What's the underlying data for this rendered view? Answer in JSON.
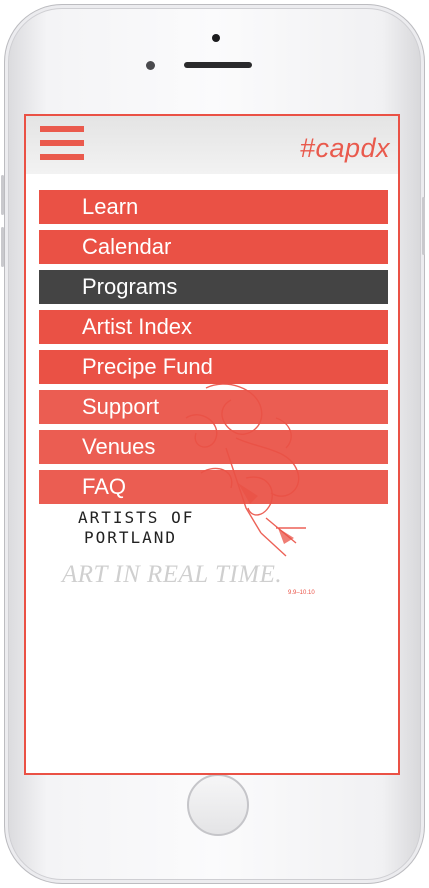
{
  "app": {
    "hashtag": "#capdx",
    "accent_color": "#ea5145",
    "active_color": "#444444"
  },
  "header": {
    "menu_icon": "hamburger-icon"
  },
  "menu": {
    "items": [
      {
        "label": "Learn"
      },
      {
        "label": "Calendar"
      },
      {
        "label": "Programs",
        "active": true
      },
      {
        "label": "Artist Index"
      },
      {
        "label": "Precipe Fund"
      },
      {
        "label": "Support"
      },
      {
        "label": "Venues"
      },
      {
        "label": "FAQ"
      }
    ]
  },
  "poster": {
    "artists_line1": "ARTISTS OF",
    "artists_line2": "PORTLAND",
    "tagline": "ART IN REAL TIME.",
    "dates": "9.9–10.10",
    "artwork_icon": "red-sketch-illustration"
  }
}
